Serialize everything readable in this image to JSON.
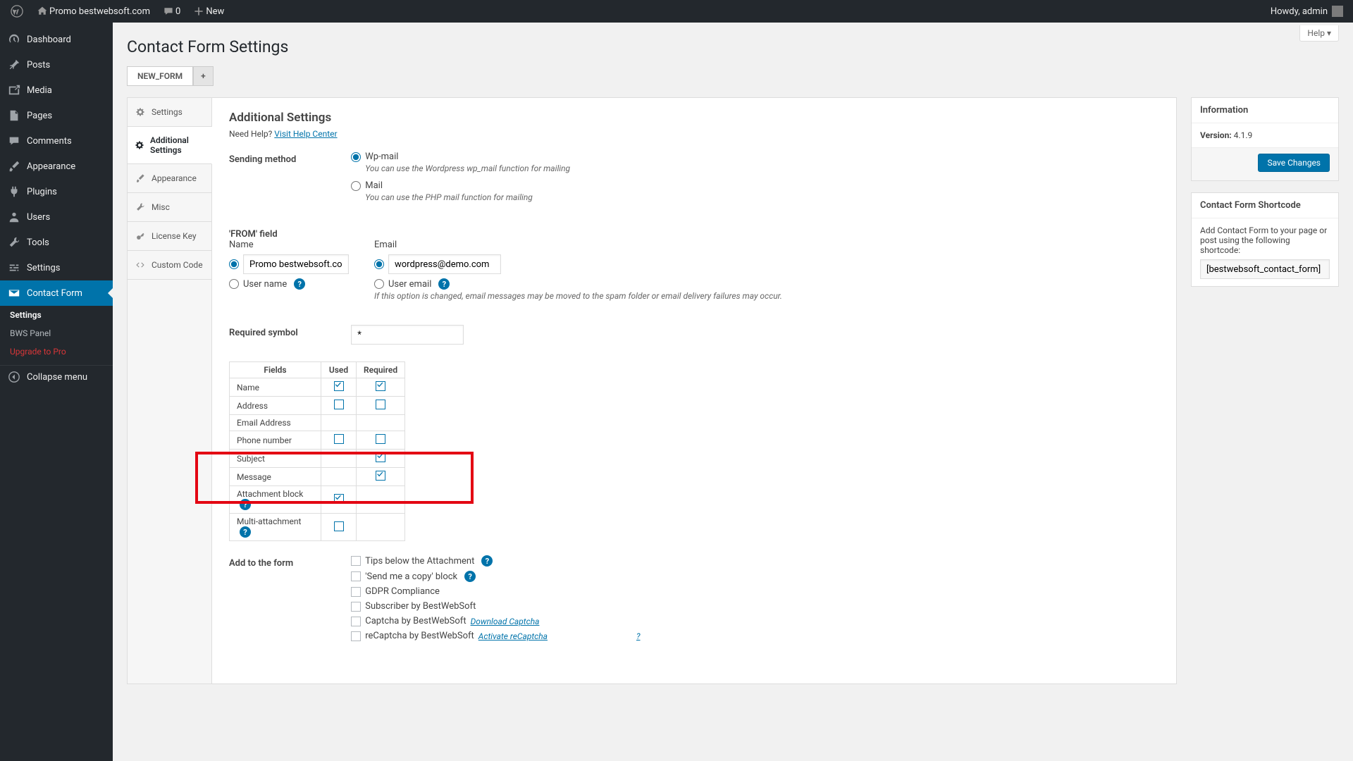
{
  "adminbar": {
    "site_name": "Promo bestwebsoft.com",
    "comments_count": "0",
    "new_label": "New",
    "howdy": "Howdy, admin"
  },
  "menu": {
    "items": [
      {
        "label": "Dashboard"
      },
      {
        "label": "Posts"
      },
      {
        "label": "Media"
      },
      {
        "label": "Pages"
      },
      {
        "label": "Comments"
      },
      {
        "label": "Appearance"
      },
      {
        "label": "Plugins"
      },
      {
        "label": "Users"
      },
      {
        "label": "Tools"
      },
      {
        "label": "Settings"
      },
      {
        "label": "Contact Form"
      }
    ],
    "sub": {
      "settings": "Settings",
      "bws_panel": "BWS Panel",
      "upgrade": "Upgrade to Pro"
    },
    "collapse": "Collapse menu"
  },
  "page": {
    "title": "Contact Form Settings",
    "help": "Help"
  },
  "form_tabs": {
    "current": "NEW_FORM",
    "add": "+"
  },
  "inner_tabs": {
    "settings": "Settings",
    "additional": "Additional Settings",
    "appearance": "Appearance",
    "misc": "Misc",
    "license": "License Key",
    "custom": "Custom Code"
  },
  "content": {
    "heading": "Additional Settings",
    "need_help": "Need Help?",
    "help_link": "Visit Help Center",
    "sending_method": {
      "label": "Sending method",
      "wp_mail": "Wp-mail",
      "wp_mail_desc": "You can use the Wordpress wp_mail function for mailing",
      "mail": "Mail",
      "mail_desc": "You can use the PHP mail function for mailing"
    },
    "from_field": {
      "label": "'FROM' field",
      "name_label": "Name",
      "name_value": "Promo bestwebsoft.com",
      "user_name": "User name",
      "email_label": "Email",
      "email_value": "wordpress@demo.com",
      "user_email": "User email",
      "email_note": "If this option is changed, email messages may be moved to the spam folder or email delivery failures may occur."
    },
    "required_symbol": {
      "label": "Required symbol",
      "value": "*"
    },
    "fields_table": {
      "h_fields": "Fields",
      "h_used": "Used",
      "h_req": "Required",
      "rows": [
        {
          "name": "Name",
          "used": true,
          "req": true
        },
        {
          "name": "Address",
          "used": false,
          "req": false
        },
        {
          "name": "Email Address",
          "used": null,
          "req": null
        },
        {
          "name": "Phone number",
          "used": false,
          "req": false
        },
        {
          "name": "Subject",
          "used": null,
          "req": true
        },
        {
          "name": "Message",
          "used": null,
          "req": true
        },
        {
          "name": "Attachment block",
          "used": true,
          "req": null,
          "q": true
        },
        {
          "name": "Multi-attachment",
          "used": false,
          "req": null,
          "q": true
        }
      ]
    },
    "add_to_form": {
      "label": "Add to the form",
      "tips": "Tips below the Attachment",
      "copy": "'Send me a copy' block",
      "gdpr": "GDPR Compliance",
      "subscriber": "Subscriber by BestWebSoft",
      "captcha": "Captcha by BestWebSoft",
      "captcha_link": "Download Captcha",
      "recaptcha": "reCaptcha by BestWebSoft",
      "recaptcha_link": "Activate reCaptcha",
      "qmark": "?"
    }
  },
  "sidebar": {
    "info_title": "Information",
    "version_label": "Version:",
    "version_value": "4.1.9",
    "save": "Save Changes",
    "shortcode_title": "Contact Form Shortcode",
    "shortcode_desc": "Add Contact Form to your page or post using the following shortcode:",
    "shortcode_value": "[bestwebsoft_contact_form]"
  }
}
